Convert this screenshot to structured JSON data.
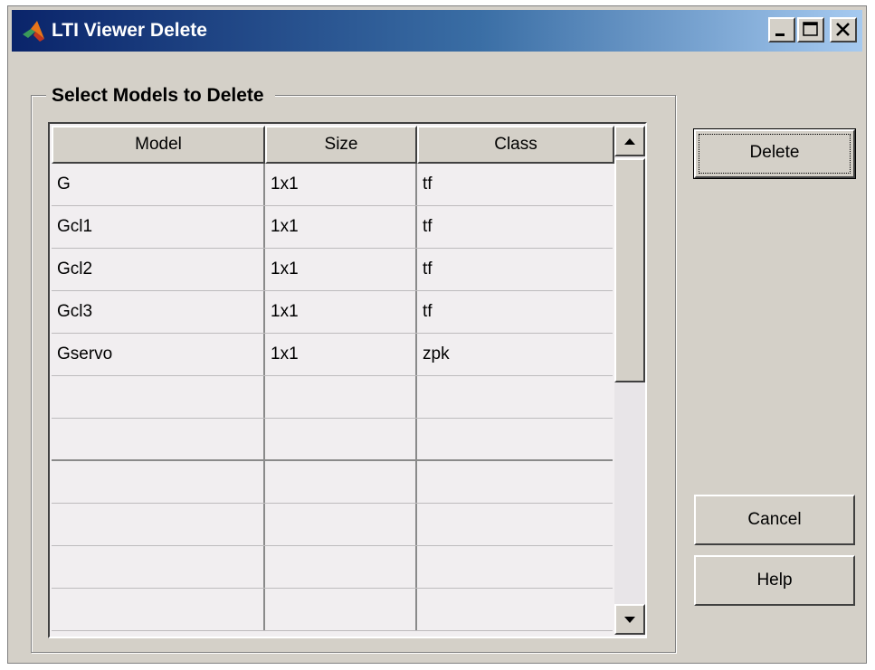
{
  "window": {
    "title": "LTI Viewer Delete",
    "icon": "matlab-logo-icon",
    "controls": [
      "minimize-icon",
      "maximize-icon",
      "close-icon"
    ]
  },
  "group": {
    "title": "Select Models to Delete"
  },
  "table": {
    "columns": [
      "Model",
      "Size",
      "Class"
    ],
    "rows": [
      {
        "model": "G",
        "size": "1x1",
        "class": "tf"
      },
      {
        "model": "Gcl1",
        "size": "1x1",
        "class": "tf"
      },
      {
        "model": "Gcl2",
        "size": "1x1",
        "class": "tf"
      },
      {
        "model": "Gcl3",
        "size": "1x1",
        "class": "tf"
      },
      {
        "model": "Gservo",
        "size": "1x1",
        "class": "zpk"
      },
      {
        "model": "",
        "size": "",
        "class": ""
      },
      {
        "model": "",
        "size": "",
        "class": ""
      },
      {
        "model": "",
        "size": "",
        "class": ""
      },
      {
        "model": "",
        "size": "",
        "class": ""
      },
      {
        "model": "",
        "size": "",
        "class": ""
      },
      {
        "model": "",
        "size": "",
        "class": ""
      }
    ]
  },
  "buttons": {
    "delete": "Delete",
    "cancel": "Cancel",
    "help": "Help"
  },
  "colors": {
    "titlebar_start": "#0a246a",
    "titlebar_end": "#a6caf0",
    "dialog_bg": "#d4d0c8",
    "table_bg": "#f1eef0"
  }
}
